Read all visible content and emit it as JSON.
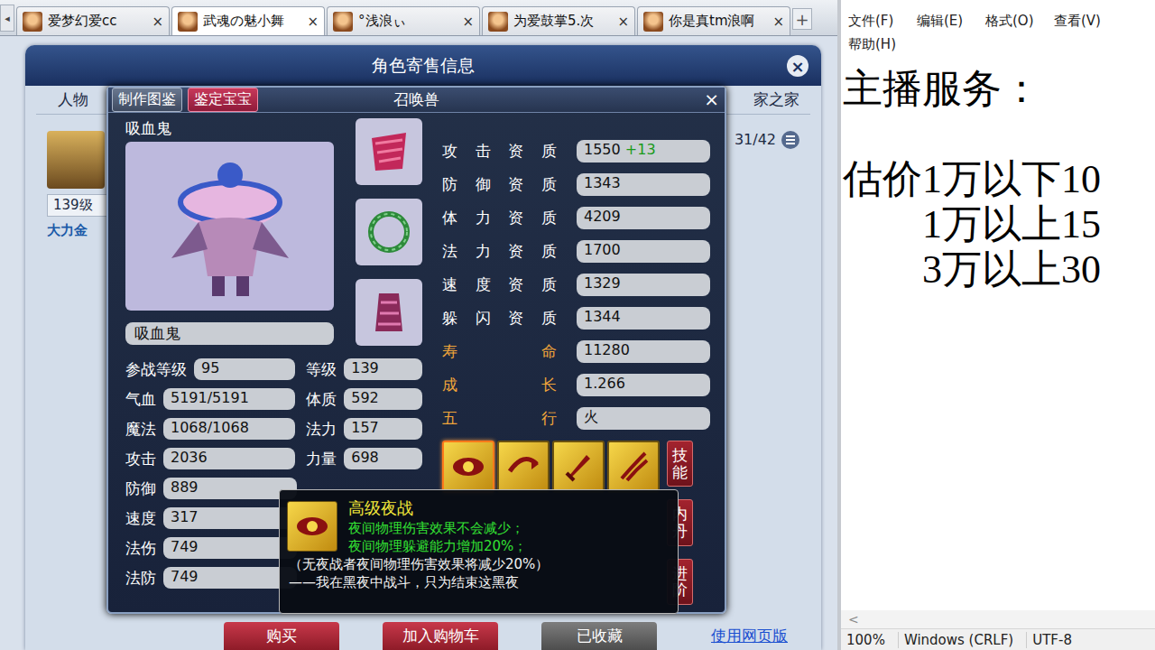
{
  "client_tabs": {
    "scroll": "◂",
    "close": "×",
    "add": "+",
    "items": [
      {
        "label": "爱梦幻爱cc",
        "selected": false
      },
      {
        "label": "武魂の魅小舞",
        "selected": true
      },
      {
        "label": "°浅浪ぃ",
        "selected": false
      },
      {
        "label": "为爱鼓掌5.次",
        "selected": false
      },
      {
        "label": "你是真tm浪啊",
        "selected": false
      }
    ]
  },
  "sale_window": {
    "title": "角色寄售信息",
    "close": "×",
    "tabs": [
      "人物",
      "家之家"
    ],
    "card": {
      "level": "139级",
      "school": "大力金"
    },
    "page": "31/42",
    "actions": [
      {
        "label": "购买",
        "kind": "primary"
      },
      {
        "label": "加入购物车",
        "kind": "primary"
      },
      {
        "label": "已收藏",
        "kind": "muted"
      },
      {
        "label": "使用网页版",
        "kind": "link"
      }
    ]
  },
  "pet": {
    "buttons": [
      {
        "label": "制作图鉴",
        "kind": "plain"
      },
      {
        "label": "鉴定宝宝",
        "kind": "red"
      }
    ],
    "title": "召唤兽",
    "close": "×",
    "name": "吸血鬼",
    "name_field": "吸血鬼",
    "stats": [
      [
        {
          "label": "参战等级",
          "value": "95"
        },
        {
          "label": "等级",
          "value": "139"
        }
      ],
      [
        {
          "label": "气血",
          "value": "5191/5191"
        },
        {
          "label": "体质",
          "value": "592"
        }
      ],
      [
        {
          "label": "魔法",
          "value": "1068/1068"
        },
        {
          "label": "法力",
          "value": "157"
        }
      ],
      [
        {
          "label": "攻击",
          "value": "2036"
        },
        {
          "label": "力量",
          "value": "698"
        }
      ],
      [
        {
          "label": "防御",
          "value": "889"
        }
      ],
      [
        {
          "label": "速度",
          "value": "317"
        }
      ],
      [
        {
          "label": "法伤",
          "value": "749"
        }
      ],
      [
        {
          "label": "法防",
          "value": "749"
        }
      ]
    ],
    "aptitudes": [
      {
        "label": "攻击资质",
        "value": "1550",
        "bonus": "+13",
        "highlight": false
      },
      {
        "label": "防御资质",
        "value": "1343",
        "bonus": "",
        "highlight": false
      },
      {
        "label": "体力资质",
        "value": "4209",
        "bonus": "",
        "highlight": false
      },
      {
        "label": "法力资质",
        "value": "1700",
        "bonus": "",
        "highlight": false
      },
      {
        "label": "速度资质",
        "value": "1329",
        "bonus": "",
        "highlight": false
      },
      {
        "label": "躲闪资质",
        "value": "1344",
        "bonus": "",
        "highlight": false
      },
      {
        "label": "寿命",
        "value": "11280",
        "bonus": "",
        "highlight": true
      },
      {
        "label": "成长",
        "value": "1.266",
        "bonus": "",
        "highlight": true
      },
      {
        "label": "五行",
        "value": "火",
        "bonus": "",
        "highlight": true
      }
    ],
    "skills": [
      {
        "selected": true
      },
      {
        "selected": false
      },
      {
        "selected": false
      },
      {
        "selected": false
      }
    ],
    "side_tabs": [
      "技能",
      "内丹",
      "进阶"
    ],
    "tooltip": {
      "title": "高级夜战",
      "effects": [
        "夜间物理伤害效果不会减少；",
        "夜间物理躲避能力增加20%；"
      ],
      "notes": [
        "（无夜战者夜间物理伤害效果将减少20%）",
        "——我在黑夜中战斗，只为结束这黑夜"
      ]
    }
  },
  "notepad": {
    "menu": [
      "文件(F)",
      "编辑(E)",
      "格式(O)",
      "查看(V)",
      "帮助(H)"
    ],
    "lines": [
      "主播服务：",
      "",
      "估价1万以下10",
      "　　1万以上15",
      "　　3万以上30"
    ],
    "scroll": "<",
    "status": [
      "100%",
      "Windows (CRLF)",
      "UTF-8"
    ]
  }
}
